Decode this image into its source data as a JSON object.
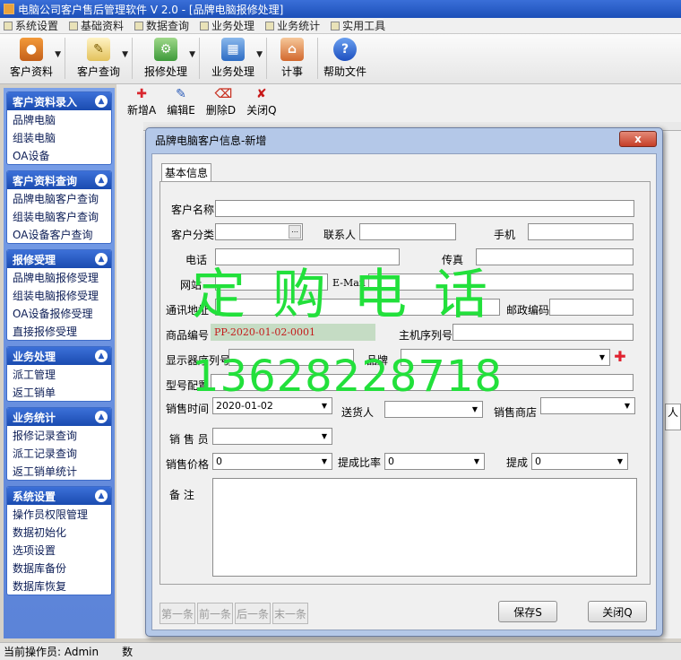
{
  "app": {
    "title": "电脑公司客户售后管理软件 V 2.0 - [品牌电脑报修处理]"
  },
  "menu": [
    "系统设置",
    "基础资料",
    "数据查询",
    "业务处理",
    "业务统计",
    "实用工具"
  ],
  "toolbar": [
    {
      "label": "客户资料",
      "icon": "users-icon",
      "has_dropdown": true
    },
    {
      "label": "客户查询",
      "icon": "search-doc-icon",
      "has_dropdown": true
    },
    {
      "label": "报修处理",
      "icon": "repair-icon",
      "has_dropdown": true
    },
    {
      "label": "业务处理",
      "icon": "business-icon",
      "has_dropdown": true
    },
    {
      "label": "计事",
      "icon": "house-icon",
      "has_dropdown": false
    },
    {
      "label": "帮助文件",
      "icon": "help-icon",
      "has_dropdown": false
    }
  ],
  "sidebar": {
    "groups": [
      {
        "title": "客户资料录入",
        "items": [
          "品牌电脑",
          "组装电脑",
          "OA设备"
        ]
      },
      {
        "title": "客户资料查询",
        "items": [
          "品牌电脑客户查询",
          "组装电脑客户查询",
          "OA设备客户查询"
        ]
      },
      {
        "title": "报修受理",
        "items": [
          "品牌电脑报修受理",
          "组装电脑报修受理",
          "OA设备报修受理",
          "直接报修受理"
        ]
      },
      {
        "title": "业务处理",
        "items": [
          "派工管理",
          "返工销单"
        ]
      },
      {
        "title": "业务统计",
        "items": [
          "报修记录查询",
          "派工记录查询",
          "返工销单统计"
        ]
      },
      {
        "title": "系统设置",
        "items": [
          "操作员权限管理",
          "数据初始化",
          "选项设置",
          "数据库备份",
          "数据库恢复"
        ]
      }
    ]
  },
  "subtoolbar": {
    "new": "新增A",
    "edit": "编辑E",
    "delete": "删除D",
    "close": "关闭Q"
  },
  "background": {
    "right_cut": "人"
  },
  "status": {
    "operator": "当前操作员: Admin",
    "extra": "数"
  },
  "dialog": {
    "title": "品牌电脑客户信息-新增",
    "tab": "基本信息",
    "labels": {
      "customer_name": "客户名称",
      "category": "客户分类",
      "contact": "联系人",
      "mobile": "手机",
      "phone": "电话",
      "fax": "传真",
      "website": "网站",
      "email": "E-Mail",
      "address": "通讯地址",
      "postcode": "邮政编码",
      "product_code": "商品编号",
      "host_serial": "主机序列号",
      "monitor_serial": "显示器序列号",
      "brand": "品牌",
      "model_config": "型号配置",
      "sale_date": "销售时间",
      "delivery": "送货人",
      "store": "销售商店",
      "salesperson": "销 售 员",
      "price": "销售价格",
      "commission_rate": "提成比率",
      "commission": "提成",
      "remark": "备 注"
    },
    "values": {
      "product_code": "PP-2020-01-02-0001",
      "sale_date": "2020-01-02",
      "price": "0",
      "commission_rate": "0",
      "commission": "0"
    },
    "buttons": {
      "first": "第一条",
      "prev": "前一条",
      "next": "后一条",
      "last": "末一条",
      "save": "保存S",
      "close": "关闭Q",
      "title_close": "x"
    }
  },
  "watermark": {
    "line1": "定购电话",
    "line2": "13628228718"
  },
  "colors": {
    "accent": "#1a4bb0",
    "watermark": "#22e03b",
    "code_bg": "#c5dcc4"
  }
}
